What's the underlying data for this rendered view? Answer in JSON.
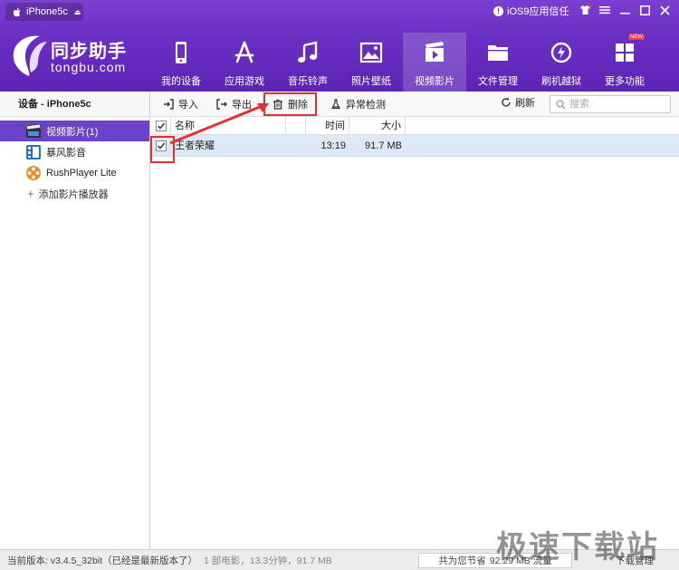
{
  "titlebar": {
    "device_name": "iPhone5c",
    "ios_trust": "iOS9应用信任"
  },
  "logo": {
    "brand": "同步助手",
    "domain": "tongbu.com"
  },
  "nav": [
    {
      "label": "我的设备",
      "icon": "phone-icon"
    },
    {
      "label": "应用游戏",
      "icon": "app-store-icon"
    },
    {
      "label": "音乐铃声",
      "icon": "music-note-icon"
    },
    {
      "label": "照片壁纸",
      "icon": "picture-icon"
    },
    {
      "label": "视频影片",
      "icon": "video-icon",
      "active": true
    },
    {
      "label": "文件管理",
      "icon": "folder-icon"
    },
    {
      "label": "刷机越狱",
      "icon": "flash-icon"
    },
    {
      "label": "更多功能",
      "icon": "grid-icon",
      "badge": "NEW"
    }
  ],
  "sidebar": {
    "title": "设备 - iPhone5c",
    "items": [
      {
        "label": "视频影片(1)",
        "icon": "clapper-icon",
        "selected": true
      },
      {
        "label": "暴风影音",
        "icon": "film-strip-icon"
      },
      {
        "label": "RushPlayer Lite",
        "icon": "reel-icon"
      }
    ],
    "add_label": "添加影片播放器"
  },
  "toolbar": {
    "import": "导入",
    "export": "导出",
    "delete": "删除",
    "check": "异常检测",
    "refresh": "刷新",
    "search_placeholder": "搜索"
  },
  "table": {
    "headers": {
      "name": "名称",
      "time": "时间",
      "size": "大小"
    },
    "rows": [
      {
        "name": "王者荣耀",
        "time": "13:19",
        "size": "91.7 MB",
        "checked": true
      }
    ]
  },
  "status": {
    "version": "当前版本: v3.4.5_32bit（已经是最新版本了）",
    "stats": "1 部电影，13.3分钟，91.7 MB",
    "savings_prefix": "共为您节省",
    "savings_value": "92.29 MB 流量",
    "download": "下载管理"
  },
  "watermark": "极速下载站",
  "colors": {
    "header": "#6a2fc3",
    "selected": "#6a43c8",
    "highlight": "#e03030",
    "row": "#dde9f6"
  }
}
